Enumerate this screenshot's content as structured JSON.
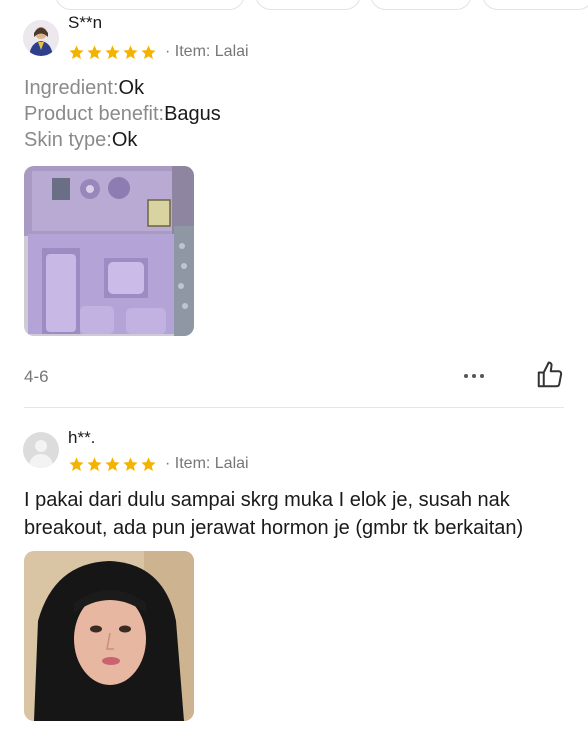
{
  "reviews": [
    {
      "username": "S**n",
      "rating": 5,
      "item_text": "· Item: Lalai",
      "attributes": [
        {
          "key": "Ingredient:",
          "value": "Ok"
        },
        {
          "key": "Product benefit:",
          "value": "Bagus"
        },
        {
          "key": "Skin type:",
          "value": "Ok"
        }
      ],
      "date": "4-6",
      "icons": {
        "more": "more-dots-icon",
        "like": "thumbs-up-icon"
      }
    },
    {
      "username": "h**.",
      "rating": 5,
      "item_text": "· Item: Lalai",
      "comment": "I pakai dari dulu sampai skrg muka I elok je, susah nak breakout, ada pun jerawat hormon je (gmbr tk berkaitan)"
    }
  ],
  "colors": {
    "star": "#f5b301",
    "muted_text": "#777777",
    "divider": "#e6e6e6",
    "photo_product_purple": "#b4a3d6"
  }
}
